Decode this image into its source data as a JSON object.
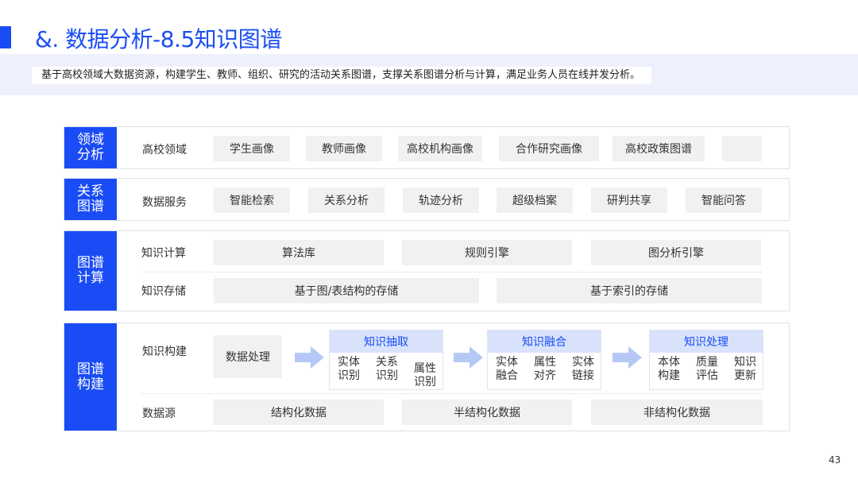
{
  "title": "&. 数据分析-8.5知识图谱",
  "subtitle": "基于高校领域大数据资源，构建学生、教师、组织、研究的活动关系图谱，支撑关系图谱分析与计算，满足业务人员在线并发分析。",
  "rows": {
    "domain": {
      "label": "领域分析",
      "category": "高校领域",
      "chips": [
        "学生画像",
        "教师画像",
        "高校机构画像",
        "合作研究画像",
        "高校政策图谱",
        ""
      ]
    },
    "relation": {
      "label": "关系图谱",
      "category": "数据服务",
      "chips": [
        "智能检索",
        "关系分析",
        "轨迹分析",
        "超级档案",
        "研判共享",
        "智能问答"
      ]
    },
    "compute": {
      "label": "图谱计算",
      "calc_category": "知识计算",
      "calc_chips": [
        "算法库",
        "规则引擎",
        "图分析引擎"
      ],
      "storage_category": "知识存储",
      "storage_chips": [
        "基于图/表结构的存储",
        "基于索引的存储"
      ]
    },
    "build": {
      "label": "图谱构建",
      "build_category": "知识构建",
      "processing": "数据处理",
      "stages": [
        {
          "title": "知识抽取",
          "items": [
            "实体识别",
            "关系识别",
            "属性识别"
          ]
        },
        {
          "title": "知识融合",
          "items": [
            "实体融合",
            "属性对齐",
            "实体链接"
          ]
        },
        {
          "title": "知识处理",
          "items": [
            "本体构建",
            "质量评估",
            "知识更新"
          ]
        }
      ],
      "source_category": "数据源",
      "sources": [
        "结构化数据",
        "半结构化数据",
        "非结构化数据"
      ]
    }
  },
  "page_number": "43",
  "colors": {
    "accent": "#1a4cf5",
    "chip": "#f1f1f2",
    "stage_header": "#d8e2fb",
    "arrow": "#b6c9f6"
  },
  "icons": {
    "flow_arrow": "arrow-right-icon"
  }
}
